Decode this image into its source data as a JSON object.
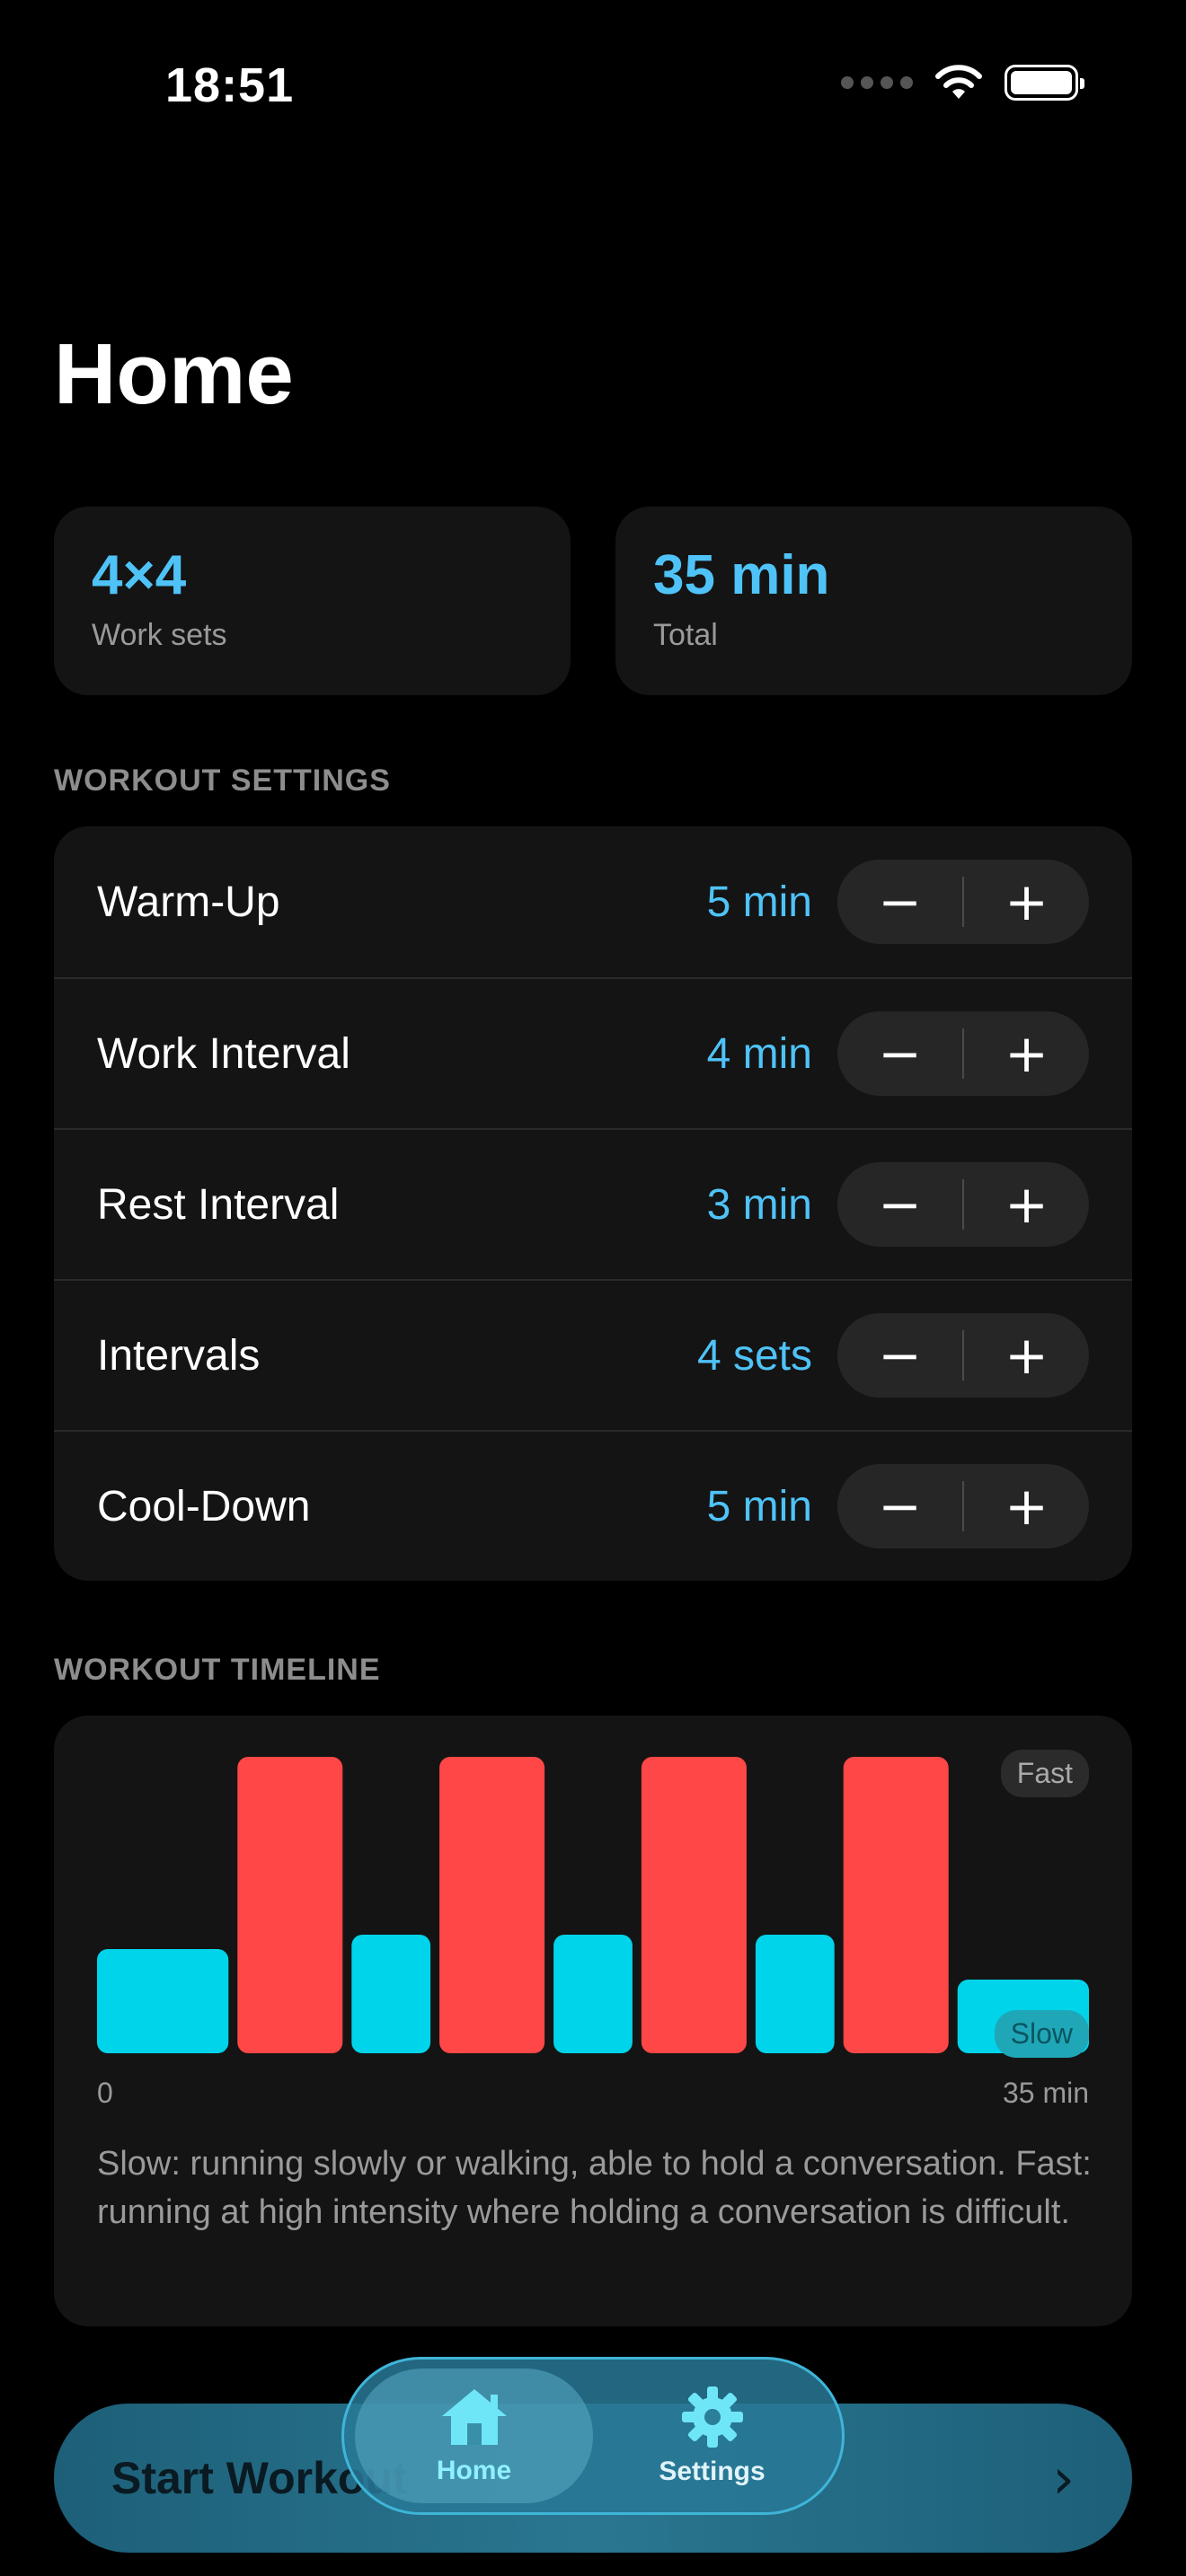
{
  "status_bar": {
    "time": "18:51"
  },
  "page_title": "Home",
  "summary": [
    {
      "value": "4×4",
      "label": "Work sets"
    },
    {
      "value": "35 min",
      "label": "Total"
    }
  ],
  "settings_section": {
    "title": "WORKOUT SETTINGS",
    "rows": [
      {
        "label": "Warm-Up",
        "value": "5 min"
      },
      {
        "label": "Work Interval",
        "value": "4 min"
      },
      {
        "label": "Rest Interval",
        "value": "3 min"
      },
      {
        "label": "Intervals",
        "value": "4 sets"
      },
      {
        "label": "Cool-Down",
        "value": "5 min"
      }
    ],
    "minus_label": "−",
    "plus_label": "+"
  },
  "timeline": {
    "title": "WORKOUT TIMELINE",
    "fast_label": "Fast",
    "slow_label": "Slow",
    "axis_start": "0",
    "axis_end": "35 min",
    "description": "Slow: running slowly or walking, able to hold a conversation. Fast: running at high intensity where holding a conversation is difficult.",
    "colors": {
      "slow": "#00d4ea",
      "fast": "#ff4747"
    }
  },
  "chart_data": {
    "type": "bar",
    "x_unit": "min",
    "xlim": [
      0,
      35
    ],
    "segments": [
      {
        "phase": "Warm-Up",
        "intensity": "Slow",
        "duration": 5
      },
      {
        "phase": "Work",
        "intensity": "Fast",
        "duration": 4
      },
      {
        "phase": "Rest",
        "intensity": "Slow",
        "duration": 3
      },
      {
        "phase": "Work",
        "intensity": "Fast",
        "duration": 4
      },
      {
        "phase": "Rest",
        "intensity": "Slow",
        "duration": 3
      },
      {
        "phase": "Work",
        "intensity": "Fast",
        "duration": 4
      },
      {
        "phase": "Rest",
        "intensity": "Slow",
        "duration": 3
      },
      {
        "phase": "Work",
        "intensity": "Fast",
        "duration": 4
      },
      {
        "phase": "Cool-Down",
        "intensity": "Slow",
        "duration": 5
      }
    ]
  },
  "start_button": {
    "label": "Start Workout",
    "chevron": "›"
  },
  "tab_bar": {
    "tabs": [
      {
        "label": "Home",
        "icon": "house-icon",
        "active": true
      },
      {
        "label": "Settings",
        "icon": "gear-icon",
        "active": false
      }
    ]
  }
}
